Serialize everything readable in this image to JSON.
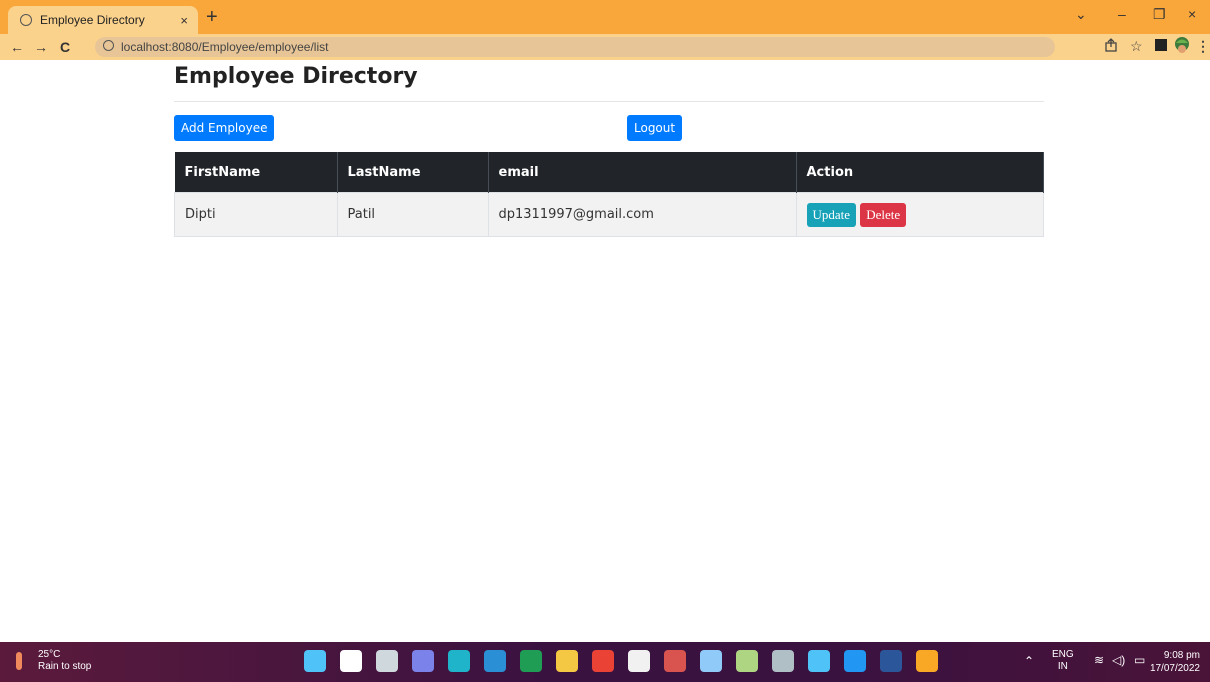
{
  "browser": {
    "tab_title": "Employee Directory",
    "tab_close": "×",
    "new_tab": "+",
    "url": "localhost:8080/Employee/employee/list",
    "controls": {
      "back": "←",
      "forward": "→",
      "reload": "C",
      "minimize": "–",
      "restore": "❐",
      "close": "×",
      "chevron": "⌄"
    }
  },
  "page": {
    "title": "Employee Directory",
    "add_button": "Add Employee",
    "logout_button": "Logout",
    "table": {
      "headers": [
        "FirstName",
        "LastName",
        "email",
        "Action"
      ],
      "rows": [
        {
          "first": "Dipti",
          "last": "Patil",
          "email": "dp1311997@gmail.com",
          "update": "Update",
          "delete": "Delete"
        }
      ]
    }
  },
  "taskbar": {
    "weather_temp": "25°C",
    "weather_desc": "Rain to stop",
    "lang_line1": "ENG",
    "lang_line2": "IN",
    "time": "9:08 pm",
    "date": "17/07/2022",
    "app_icons": [
      {
        "name": "windows-start-icon",
        "color": "#4fc3f7"
      },
      {
        "name": "search-icon",
        "color": "#ffffff"
      },
      {
        "name": "task-view-icon",
        "color": "#cfd8dc"
      },
      {
        "name": "teams-chat-icon",
        "color": "#7b83eb"
      },
      {
        "name": "edge-icon",
        "color": "#1fb4c9"
      },
      {
        "name": "photos-icon",
        "color": "#2b8fd6"
      },
      {
        "name": "excel-icon",
        "color": "#1f9d55"
      },
      {
        "name": "file-explorer-icon",
        "color": "#f4c842"
      },
      {
        "name": "chrome-icon",
        "color": "#ea4335"
      },
      {
        "name": "store-icon",
        "color": "#f1f1f1"
      },
      {
        "name": "mp3-cutter-icon",
        "color": "#d9534f"
      },
      {
        "name": "notepad-icon",
        "color": "#90caf9"
      },
      {
        "name": "calculator-icon",
        "color": "#aed581"
      },
      {
        "name": "settings-icon",
        "color": "#b0bec5"
      },
      {
        "name": "sts-icon",
        "color": "#4fc3f7"
      },
      {
        "name": "skype-icon",
        "color": "#2196f3"
      },
      {
        "name": "word-icon",
        "color": "#2b579a"
      },
      {
        "name": "chrome-canary-icon",
        "color": "#f9a825"
      }
    ]
  }
}
